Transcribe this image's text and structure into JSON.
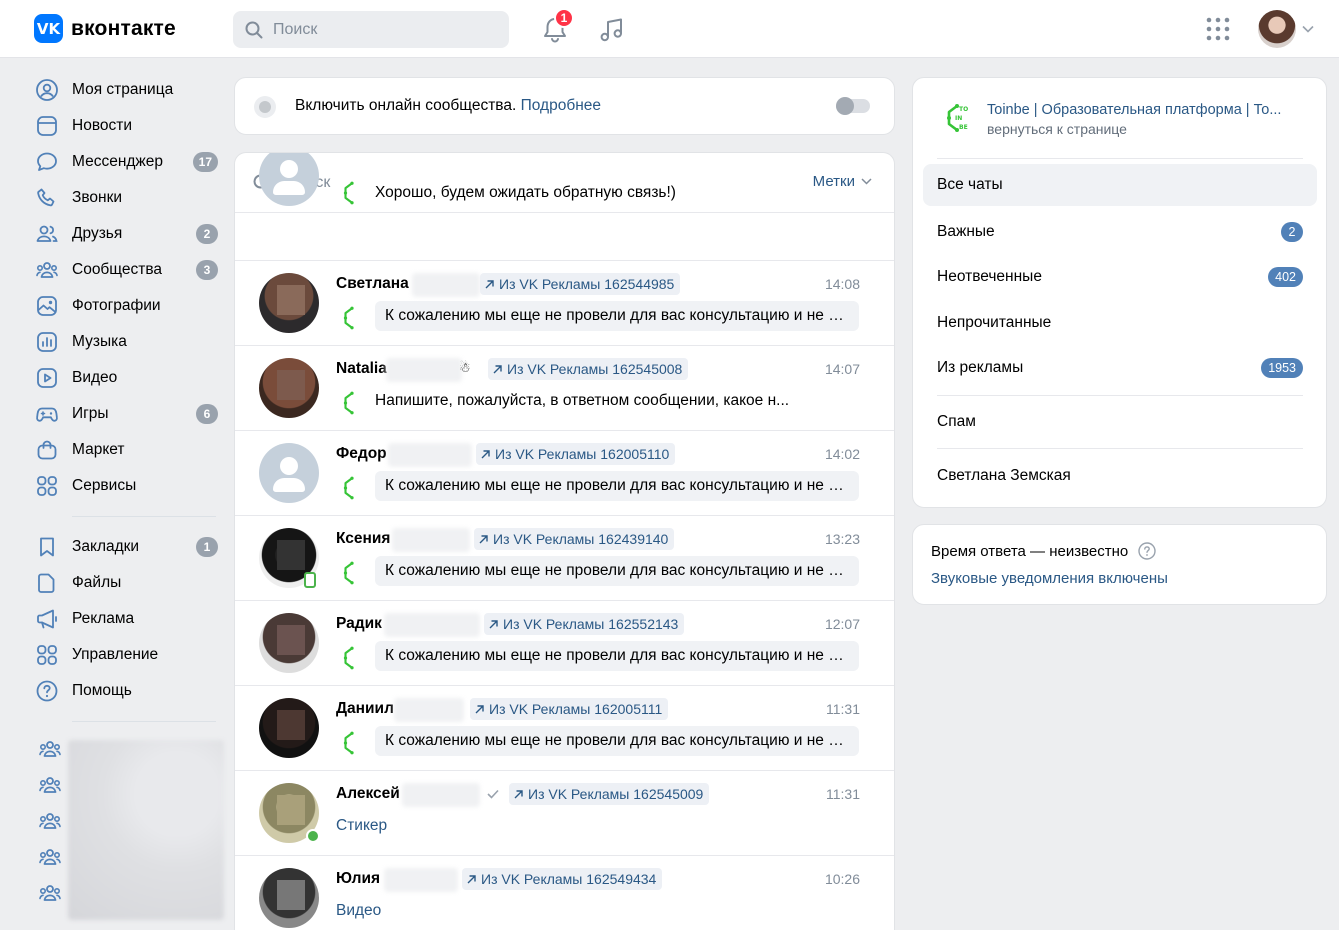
{
  "header": {
    "logo_text": "вконтакте",
    "logo_mark": "VK",
    "search_placeholder": "Поиск",
    "notifications_count": "1"
  },
  "sidebar": {
    "items": [
      {
        "label": "Моя страница",
        "icon": "user-circle-icon",
        "badge": ""
      },
      {
        "label": "Новости",
        "icon": "news-icon",
        "badge": ""
      },
      {
        "label": "Мессенджер",
        "icon": "message-icon",
        "badge": "17"
      },
      {
        "label": "Звонки",
        "icon": "phone-icon",
        "badge": ""
      },
      {
        "label": "Друзья",
        "icon": "friends-icon",
        "badge": "2"
      },
      {
        "label": "Сообщества",
        "icon": "communities-icon",
        "badge": "3"
      },
      {
        "label": "Фотографии",
        "icon": "photos-icon",
        "badge": ""
      },
      {
        "label": "Музыка",
        "icon": "music-icon",
        "badge": ""
      },
      {
        "label": "Видео",
        "icon": "video-icon",
        "badge": ""
      },
      {
        "label": "Игры",
        "icon": "games-icon",
        "badge": "6"
      },
      {
        "label": "Маркет",
        "icon": "market-icon",
        "badge": ""
      },
      {
        "label": "Сервисы",
        "icon": "services-icon",
        "badge": ""
      }
    ],
    "items2": [
      {
        "label": "Закладки",
        "icon": "bookmark-icon",
        "badge": "1"
      },
      {
        "label": "Файлы",
        "icon": "file-icon",
        "badge": ""
      },
      {
        "label": "Реклама",
        "icon": "megaphone-icon",
        "badge": ""
      },
      {
        "label": "Управление",
        "icon": "manage-icon",
        "badge": ""
      },
      {
        "label": "Помощь",
        "icon": "help-icon",
        "badge": ""
      }
    ]
  },
  "banner": {
    "text": "Включить онлайн сообщества.",
    "link": "Подробнее"
  },
  "chat_list": {
    "search_placeholder": "Поиск",
    "tags_label": "Метки",
    "rows": [
      {
        "name": "",
        "tag": "",
        "time": "",
        "message": "Хорошо, будем ожидать обратную связь!)",
        "style": "plain"
      },
      {
        "name": "Светлана",
        "tag": "Из VK Рекламы 162544985",
        "time": "14:08",
        "message": "К сожалению мы еще не провели для вас консультацию и не н...",
        "style": "bubble"
      },
      {
        "name": "Natalia",
        "tag": "Из VK Рекламы 162545008",
        "time": "14:07",
        "message": "Напишите, пожалуйста, в ответном сообщении, какое н...",
        "style": "plain"
      },
      {
        "name": "Федор",
        "tag": "Из VK Рекламы 162005110",
        "time": "14:02",
        "message": "К сожалению мы еще не провели для вас консультацию и не н...",
        "style": "bubble"
      },
      {
        "name": "Ксения",
        "tag": "Из VK Рекламы 162439140",
        "time": "13:23",
        "message": "К сожалению мы еще не провели для вас консультацию и не н...",
        "style": "bubble"
      },
      {
        "name": "Радик",
        "tag": "Из VK Рекламы 162552143",
        "time": "12:07",
        "message": "К сожалению мы еще не провели для вас консультацию и не н...",
        "style": "bubble"
      },
      {
        "name": "Даниил",
        "tag": "Из VK Рекламы 162005111",
        "time": "11:31",
        "message": "К сожалению мы еще не провели для вас консультацию и не н...",
        "style": "bubble"
      },
      {
        "name": "Алексей",
        "tag": "Из VK Рекламы 162545009",
        "time": "11:31",
        "message": "Стикер",
        "style": "link"
      },
      {
        "name": "Юлия",
        "tag": "Из VK Рекламы 162549434",
        "time": "10:26",
        "message": "Видео",
        "style": "link"
      }
    ]
  },
  "right_panel": {
    "community_name": "Toinbe | Образовательная платформа | То...",
    "back_link": "вернуться к странице",
    "folders": [
      {
        "label": "Все чаты",
        "count": ""
      },
      {
        "label": "Важные",
        "count": "2"
      },
      {
        "label": "Неотвеченные",
        "count": "402"
      },
      {
        "label": "Непрочитанные",
        "count": ""
      },
      {
        "label": "Из рекламы",
        "count": "1953"
      },
      {
        "label": "Спам",
        "count": ""
      },
      {
        "label": "Светлана Земская",
        "count": ""
      }
    ]
  },
  "info": {
    "response_time": "Время ответа — неизвестно",
    "sound_link": "Звуковые уведомления включены"
  },
  "colors": {
    "accent": "#0077ff",
    "link": "#2a5885",
    "badge_blue": "#5181b8",
    "badge_gray": "#99a2ad",
    "online": "#4bb34b",
    "notify": "#ff3347"
  }
}
